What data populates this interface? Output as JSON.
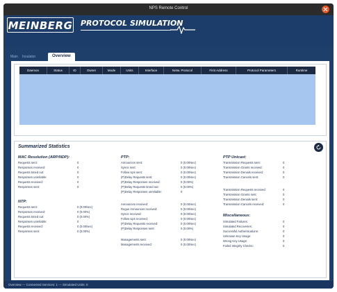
{
  "window": {
    "title": "NPS Remote Control"
  },
  "brand": {
    "logo": "MEINBERG",
    "subtitle": "PROTOCOL SIMULATION"
  },
  "tabs": [
    {
      "label": "Main",
      "active": false
    },
    {
      "label": "Insulator",
      "active": false
    },
    {
      "label": "Overview",
      "active": true
    }
  ],
  "grid": {
    "columns": [
      "Daemon",
      "Status",
      "ID",
      "Owner",
      "Mode",
      "Units",
      "Interface",
      "Netw. Protocol",
      "First Address",
      "Protocol Parameters",
      "Runtime"
    ]
  },
  "stats": {
    "title": "Summarized Statistics",
    "mac": {
      "title": "MAC Resolution (ARP/NDP):",
      "rows": [
        {
          "label": "Requests sent:",
          "value": "0"
        },
        {
          "label": "Responses received:",
          "value": "0"
        },
        {
          "label": "Requests timed out:",
          "value": "0"
        },
        {
          "label": "Responses unreliable:",
          "value": "0"
        },
        {
          "label": "Requests received:",
          "value": "0"
        },
        {
          "label": "Responses sent:",
          "value": "0"
        }
      ]
    },
    "ntp": {
      "title": "NTP:",
      "rows": [
        {
          "label": "Requests sent:",
          "value": "0 (0.00/sec)"
        },
        {
          "label": "Responses received:",
          "value": "0 (0.00%)"
        },
        {
          "label": "Requests timed out:",
          "value": "0 (0.00%)"
        },
        {
          "label": "Responses unreliable:",
          "value": "0"
        },
        {
          "label": "Requests received:",
          "value": "0 (0.00/sec)"
        },
        {
          "label": "Responses sent:",
          "value": "0 (0.00%)"
        }
      ]
    },
    "ptp": {
      "title": "PTP:",
      "group1": [
        {
          "label": "Announces sent:",
          "value": "0 (0.00/sec)"
        },
        {
          "label": "Syncs sent:",
          "value": "0 (0.00/sec)"
        },
        {
          "label": "Follow Ups sent:",
          "value": "0 (0.00/sec)"
        },
        {
          "label": "(P)Delay Requests sent:",
          "value": "0 (0.00/sec)"
        },
        {
          "label": "(P)Delay Responses received:",
          "value": "0 (0.00%)"
        },
        {
          "label": "(P)Delay Requests timed out:",
          "value": "0 (0.00%)"
        },
        {
          "label": "(P)Delay Responses unreliable:",
          "value": "0"
        }
      ],
      "group2": [
        {
          "label": "Announces received:",
          "value": "0 (0.00/sec)"
        },
        {
          "label": "Rogue Announces received:",
          "value": "0 (0.00/sec)"
        },
        {
          "label": "Syncs received:",
          "value": "0 (0.00/sec)"
        },
        {
          "label": "Follow Ups received:",
          "value": "0 (0.00/sec)"
        },
        {
          "label": "(P)Delay Requests received:",
          "value": "0 (0.00/sec)"
        },
        {
          "label": "(P)Delay Responses sent:",
          "value": "0 (0.00%)"
        }
      ],
      "group3": [
        {
          "label": "Managements sent:",
          "value": "0 (0.00/sec)"
        },
        {
          "label": "Managements received:",
          "value": "0 (0.00/sec)"
        }
      ]
    },
    "ptp_unicast": {
      "title": "PTP Unicast:",
      "group1": [
        {
          "label": "Transmission Requests sent:",
          "value": "0"
        },
        {
          "label": "Transmission Grants received:",
          "value": "0"
        },
        {
          "label": "Transmission Denials received:",
          "value": "0"
        },
        {
          "label": "Transmission Cancels sent:",
          "value": "0"
        }
      ],
      "group2": [
        {
          "label": "Transmission Requests received:",
          "value": "0"
        },
        {
          "label": "Transmission Grants sent:",
          "value": "0"
        },
        {
          "label": "Transmission Denials sent:",
          "value": "0"
        },
        {
          "label": "Transmission Cancels received:",
          "value": "0"
        }
      ]
    },
    "misc": {
      "title": "Miscellaneous:",
      "rows": [
        {
          "label": "Simulated Failures:",
          "value": "0"
        },
        {
          "label": "Simulated Recoveries:",
          "value": "0"
        },
        {
          "label": "Successful Authentications:",
          "value": "0"
        },
        {
          "label": "Unknown Key Usage:",
          "value": "0"
        },
        {
          "label": "Wrong Key Usage:",
          "value": "0"
        },
        {
          "label": "Failed Integrity Checks:",
          "value": "0"
        }
      ]
    }
  },
  "statusbar": {
    "text": "Overview --- Connected Services: 1 --- Simulated Units: 0"
  }
}
